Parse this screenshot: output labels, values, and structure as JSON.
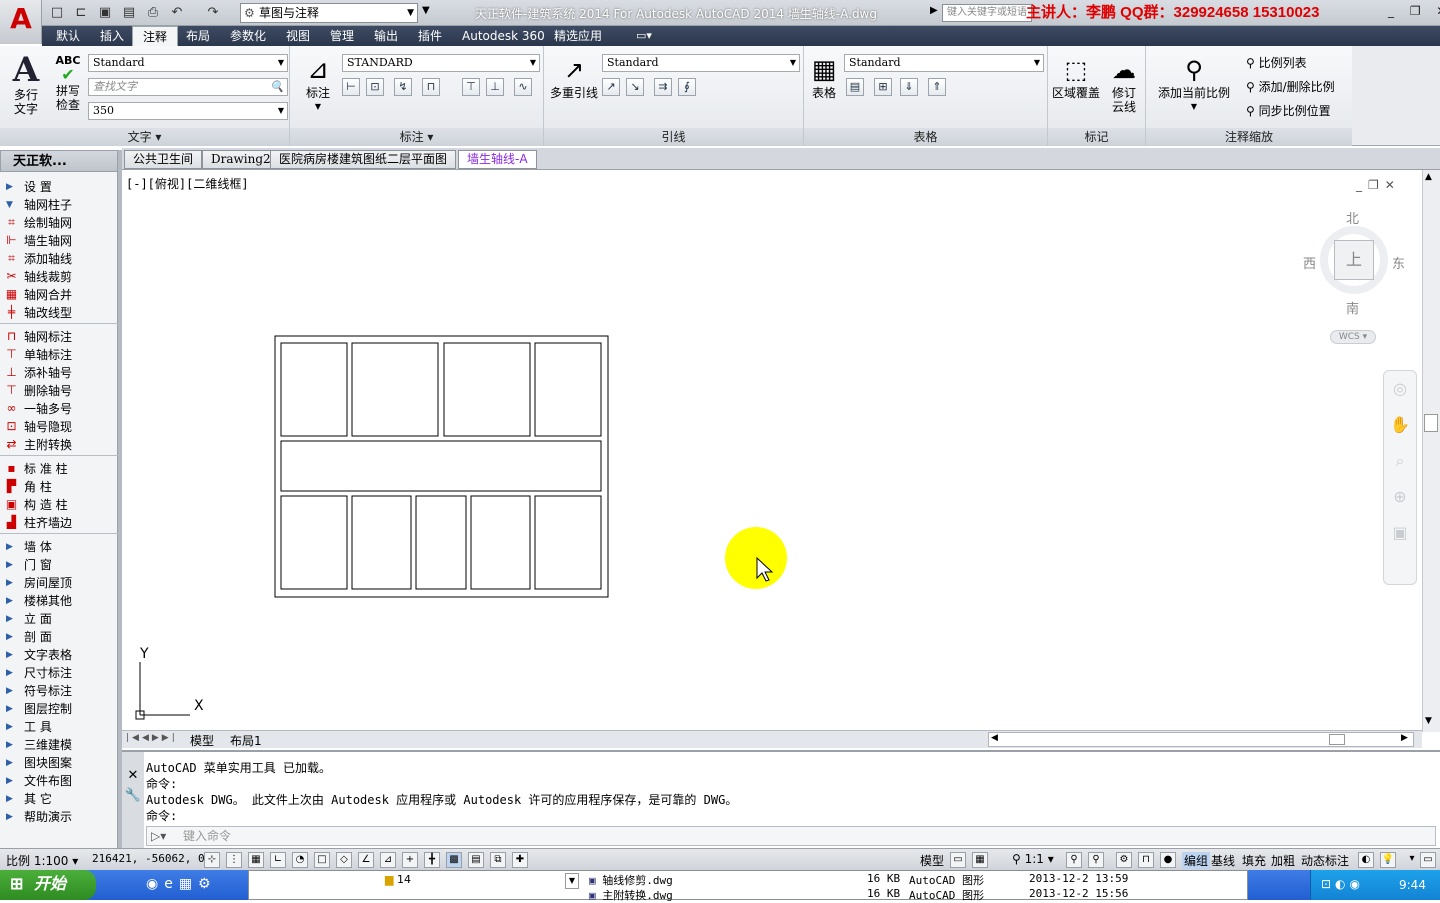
{
  "titlebar": {
    "workspace": "草图与注释",
    "title": "天正软件-建筑系统 2014  For Autodesk AutoCAD 2014    墙生轴线-A.dwg",
    "search_placeholder": "键入关键字或短语",
    "presenter": "主讲人：李鹏   QQ群：329924658   15310023",
    "icons": [
      "new-icon",
      "open-icon",
      "save-icon",
      "saveas-icon",
      "print-icon",
      "undo-icon",
      "redo-icon"
    ]
  },
  "ribbon_tabs": [
    "默认",
    "插入",
    "注释",
    "布局",
    "参数化",
    "视图",
    "管理",
    "输出",
    "插件",
    "Autodesk 360",
    "精选应用"
  ],
  "ribbon": {
    "text_panel": {
      "title": "文字",
      "mtext_label": "多行\n文字",
      "spell_label": "拼写\n检查",
      "style": "Standard",
      "find_placeholder": "查找文字",
      "height": "350"
    },
    "dim_panel": {
      "title": "标注",
      "dim_label": "标注",
      "style": "STANDARD"
    },
    "leader_panel": {
      "title": "引线",
      "mleader_label": "多重引线",
      "style": "Standard"
    },
    "table_panel": {
      "title": "表格",
      "table_label": "表格",
      "style": "Standard"
    },
    "markup_panel": {
      "title": "标记",
      "wipeout_label": "区域覆盖",
      "revcloud_label": "修订\n云线"
    },
    "scale_panel": {
      "title": "注释缩放",
      "add_label": "添加当前比例",
      "list_label": "比例列表",
      "adddel_label": "添加/删除比例",
      "sync_label": "同步比例位置"
    }
  },
  "sidebar": {
    "title": "天正软...",
    "items": [
      {
        "label": "设    置",
        "type": "group",
        "icon": "expand-arrow-icon"
      },
      {
        "label": "轴网柱子",
        "type": "group-open",
        "icon": "collapse-arrow-icon"
      },
      {
        "label": "绘制轴网",
        "type": "cmd",
        "icon": "grid-draw-icon"
      },
      {
        "label": "墙生轴网",
        "type": "cmd",
        "icon": "wall-grid-icon"
      },
      {
        "label": "添加轴线",
        "type": "cmd",
        "icon": "add-axis-icon"
      },
      {
        "label": "轴线裁剪",
        "type": "cmd",
        "icon": "trim-axis-icon"
      },
      {
        "label": "轴网合并",
        "type": "cmd",
        "icon": "merge-grid-icon"
      },
      {
        "label": "轴改线型",
        "type": "cmd",
        "icon": "linetype-icon"
      },
      {
        "label": "轴网标注",
        "type": "cmd",
        "icon": "grid-dim-icon"
      },
      {
        "label": "单轴标注",
        "type": "cmd",
        "icon": "single-dim-icon"
      },
      {
        "label": "添补轴号",
        "type": "cmd",
        "icon": "add-number-icon"
      },
      {
        "label": "删除轴号",
        "type": "cmd",
        "icon": "delete-number-icon"
      },
      {
        "label": "一轴多号",
        "type": "cmd",
        "icon": "multi-number-icon"
      },
      {
        "label": "轴号隐现",
        "type": "cmd",
        "icon": "toggle-number-icon"
      },
      {
        "label": "主附转换",
        "type": "cmd",
        "icon": "convert-icon"
      },
      {
        "label": "标 准 柱",
        "type": "cmd",
        "icon": "std-column-icon"
      },
      {
        "label": "角    柱",
        "type": "cmd",
        "icon": "corner-column-icon"
      },
      {
        "label": "构 造 柱",
        "type": "cmd",
        "icon": "struct-column-icon"
      },
      {
        "label": "柱齐墙边",
        "type": "cmd",
        "icon": "align-column-icon"
      },
      {
        "label": "墙    体",
        "type": "group",
        "icon": "expand-arrow-icon"
      },
      {
        "label": "门    窗",
        "type": "group",
        "icon": "expand-arrow-icon"
      },
      {
        "label": "房间屋顶",
        "type": "group",
        "icon": "expand-arrow-icon"
      },
      {
        "label": "楼梯其他",
        "type": "group",
        "icon": "expand-arrow-icon"
      },
      {
        "label": "立    面",
        "type": "group",
        "icon": "expand-arrow-icon"
      },
      {
        "label": "剖    面",
        "type": "group",
        "icon": "expand-arrow-icon"
      },
      {
        "label": "文字表格",
        "type": "group",
        "icon": "expand-arrow-icon"
      },
      {
        "label": "尺寸标注",
        "type": "group",
        "icon": "expand-arrow-icon"
      },
      {
        "label": "符号标注",
        "type": "group",
        "icon": "expand-arrow-icon"
      },
      {
        "label": "图层控制",
        "type": "group",
        "icon": "expand-arrow-icon"
      },
      {
        "label": "工    具",
        "type": "group",
        "icon": "expand-arrow-icon"
      },
      {
        "label": "三维建模",
        "type": "group",
        "icon": "expand-arrow-icon"
      },
      {
        "label": "图块图案",
        "type": "group",
        "icon": "expand-arrow-icon"
      },
      {
        "label": "文件布图",
        "type": "group",
        "icon": "expand-arrow-icon"
      },
      {
        "label": "其    它",
        "type": "group",
        "icon": "expand-arrow-icon"
      },
      {
        "label": "帮助演示",
        "type": "group",
        "icon": "expand-arrow-icon"
      }
    ]
  },
  "doc_tabs": [
    "公共卫生间",
    "Drawing2",
    "医院病房楼建筑图纸二层平面图",
    "墙生轴线-A"
  ],
  "viewport": {
    "label": "[-][俯视][二维线框]",
    "viewcube": {
      "north": "北",
      "south": "南",
      "east": "东",
      "west": "西",
      "top": "上",
      "wcs": "WCS"
    },
    "ucs_x": "X",
    "ucs_y": "Y"
  },
  "layout_tabs": [
    "模型",
    "布局1"
  ],
  "command": {
    "lines": [
      "AutoCAD 菜单实用工具 已加载。",
      "命令:",
      "Autodesk DWG。  此文件上次由 Autodesk 应用程序或 Autodesk 许可的应用程序保存，是可靠的 DWG。",
      "命令:"
    ],
    "placeholder": "键入命令"
  },
  "statusbar": {
    "scale": "比例 1:100",
    "coords": "216421, -56062, 0",
    "model_label": "模型",
    "anno_scale": "1:1",
    "toggles": [
      "编组",
      "基线",
      "填充",
      "加粗",
      "动态标注"
    ]
  },
  "taskbar": {
    "start": "开始",
    "clock": "9:44",
    "explorer": {
      "folder": "14",
      "files": [
        {
          "name": "轴线修剪.dwg",
          "size": "16 KB",
          "type": "AutoCAD 图形",
          "date": "2013-12-2 13:59"
        },
        {
          "name": "主附转换.dwg",
          "size": "16 KB",
          "type": "AutoCAD 图形",
          "date": "2013-12-2 15:56"
        }
      ]
    }
  },
  "colors": {
    "accent": "#2a364b",
    "cursor_highlight": "#ffff00",
    "presenter": "#e00000"
  }
}
